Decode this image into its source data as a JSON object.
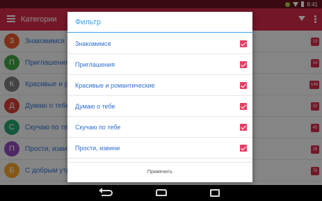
{
  "status_bar": {
    "time": "8:41",
    "icons": [
      "android-icon",
      "wifi-icon",
      "battery-icon"
    ]
  },
  "app_bar": {
    "title": "Категории",
    "icons": [
      "menu-icon",
      "filter-icon",
      "overflow-icon"
    ]
  },
  "categories": [
    {
      "letter": "З",
      "label": "Знакомимся",
      "count": "13",
      "color": "#e7582c"
    },
    {
      "letter": "П",
      "label": "Приглашения",
      "count": "14",
      "color": "#3fa343"
    },
    {
      "letter": "К",
      "label": "Красивые и романтические",
      "count": "148",
      "color": "#7a7a7a"
    },
    {
      "letter": "Д",
      "label": "Думаю о тебе",
      "count": "32",
      "color": "#d13c36"
    },
    {
      "letter": "С",
      "label": "Скучаю по тебе",
      "count": "45",
      "color": "#26a16e"
    },
    {
      "letter": "П",
      "label": "Прости, извини",
      "count": "28",
      "color": "#8e49b5"
    },
    {
      "letter": "Б",
      "label": "С добрым утром",
      "count": "76",
      "color": "#f0a22b"
    }
  ],
  "filter_dialog": {
    "title": "Фильтр",
    "options": [
      {
        "label": "Знакомимся",
        "checked": true
      },
      {
        "label": "Приглашения",
        "checked": true
      },
      {
        "label": "Красивые и романтические",
        "checked": true
      },
      {
        "label": "Думаю о тебе",
        "checked": true
      },
      {
        "label": "Скучаю по тебе",
        "checked": true
      },
      {
        "label": "Прости, извини",
        "checked": true
      }
    ],
    "apply_label": "Применить"
  },
  "colors": {
    "accent": "#d22a48",
    "dialog_title": "#3aa0ea",
    "checkbox": "#e83d63",
    "link_text": "#2f6fd0"
  }
}
